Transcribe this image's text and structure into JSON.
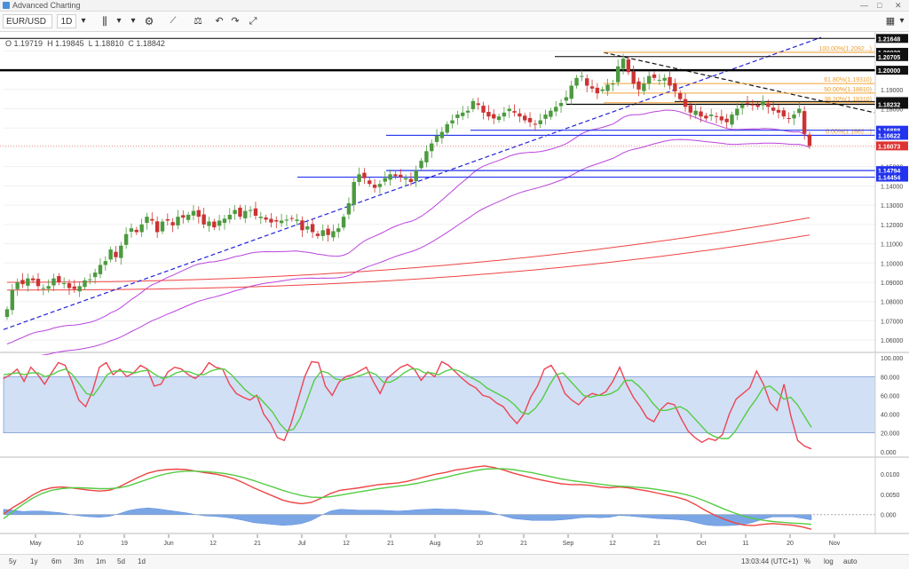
{
  "window": {
    "title": "Advanced Charting",
    "min": "—",
    "max": "□",
    "close": "✕"
  },
  "toolbar": {
    "symbol": "EUR/USD",
    "interval": "1D"
  },
  "ohlc": {
    "o": "O 1.19719",
    "h": "H 1.19845",
    "l": "L 1.18810",
    "c": "C 1.18842"
  },
  "bottom": {
    "ranges": [
      "5y",
      "1y",
      "6m",
      "3m",
      "1m",
      "5d",
      "1d"
    ],
    "time": "13:03:44 (UTC+1)",
    "pct": "%",
    "log": "log",
    "auto": "auto"
  },
  "colors": {
    "candle_up": "#4c9a3f",
    "candle_down": "#cc3333",
    "fib": "#f0a030",
    "trend_blue": "#2222dd",
    "ma_purple": "#bb44dd",
    "ma_red": "#ee4444",
    "rsi_red": "#ee4455",
    "rsi_green": "#55cc44",
    "band": "#c5d8f2",
    "hist": "#7aa6e6"
  },
  "chart_data": [
    {
      "type": "candlestick",
      "title": "EUR/USD",
      "ylim": [
        1.055,
        1.218
      ],
      "y_ticks": [
        1.06,
        1.07,
        1.08,
        1.09,
        1.1,
        1.11,
        1.12,
        1.13,
        1.14,
        1.15,
        1.16,
        1.17,
        1.18,
        1.19,
        1.2,
        1.21
      ],
      "y_tick_labels": [
        "1.06000",
        "1.07000",
        "1.08000",
        "1.09000",
        "1.10000",
        "1.11000",
        "1.12000",
        "1.13000",
        "1.14000",
        "1.15000",
        "1.16000",
        "1.17000",
        "1.18000",
        "1.19000",
        "1.20000",
        "1.21000"
      ],
      "x_ticks": [
        "May",
        "10",
        "19",
        "Jun",
        "12",
        "21",
        "Jul",
        "12",
        "21",
        "Aug",
        "10",
        "21",
        "Sep",
        "12",
        "21",
        "Oct",
        "11",
        "20",
        "Nov"
      ],
      "price_levels": [
        {
          "label": "1.21648",
          "value": 1.21648,
          "style": "plain"
        },
        {
          "label": "1.20928",
          "value": 1.20928,
          "style": "plain"
        },
        {
          "label": "1.20705",
          "value": 1.20705,
          "style": "plain"
        },
        {
          "label": "1.20000",
          "value": 1.2,
          "style": "plain"
        },
        {
          "label": "1.18373",
          "value": 1.18373,
          "style": "plain"
        },
        {
          "label": "1.18232",
          "value": 1.18232,
          "style": "plain"
        },
        {
          "label": "1.16888",
          "value": 1.16888,
          "style": "blue"
        },
        {
          "label": "1.16622",
          "value": 1.16622,
          "style": "blue"
        },
        {
          "label": "1.16073",
          "value": 1.16073,
          "style": "red"
        },
        {
          "label": "1.14794",
          "value": 1.14794,
          "style": "blue"
        },
        {
          "label": "1.14454",
          "value": 1.14454,
          "style": "blue"
        }
      ],
      "fib_labels": [
        {
          "label": "100.00%(1.2092...)",
          "value": 1.20928
        },
        {
          "label": "61.80%(1.19310)",
          "value": 1.1931
        },
        {
          "label": "50.00%(1.18810)",
          "value": 1.1881
        },
        {
          "label": "38.20%(1.18310)",
          "value": 1.1831
        },
        {
          "label": "0.00%(1.1662...)",
          "value": 1.16622
        }
      ],
      "closes": [
        1.076,
        1.086,
        1.09,
        1.089,
        1.092,
        1.091,
        1.088,
        1.087,
        1.088,
        1.092,
        1.09,
        1.0895,
        1.087,
        1.0865,
        1.088,
        1.091,
        1.0915,
        1.095,
        1.099,
        1.101,
        1.107,
        1.103,
        1.109,
        1.115,
        1.118,
        1.116,
        1.12,
        1.124,
        1.122,
        1.116,
        1.1215,
        1.122,
        1.1195,
        1.124,
        1.1235,
        1.125,
        1.127,
        1.124,
        1.12,
        1.1215,
        1.1185,
        1.122,
        1.123,
        1.125,
        1.1275,
        1.124,
        1.127,
        1.1275,
        1.1245,
        1.124,
        1.1225,
        1.121,
        1.1215,
        1.122,
        1.1225,
        1.123,
        1.1225,
        1.117,
        1.119,
        1.116,
        1.114,
        1.117,
        1.1145,
        1.1165,
        1.118,
        1.124,
        1.131,
        1.142,
        1.146,
        1.144,
        1.141,
        1.139,
        1.141,
        1.144,
        1.146,
        1.145,
        1.1445,
        1.144,
        1.142,
        1.148,
        1.153,
        1.158,
        1.162,
        1.166,
        1.168,
        1.172,
        1.174,
        1.177,
        1.178,
        1.179,
        1.184,
        1.182,
        1.178,
        1.176,
        1.175,
        1.176,
        1.178,
        1.18,
        1.178,
        1.176,
        1.174,
        1.173,
        1.172,
        1.174,
        1.177,
        1.179,
        1.181,
        1.183,
        1.186,
        1.192,
        1.196,
        1.197,
        1.192,
        1.1905,
        1.188,
        1.19,
        1.1925,
        1.193,
        1.202,
        1.206,
        1.199,
        1.193,
        1.19,
        1.193,
        1.197,
        1.196,
        1.195,
        1.196,
        1.192,
        1.189,
        1.185,
        1.181,
        1.178,
        1.179,
        1.176,
        1.175,
        1.177,
        1.176,
        1.174,
        1.173,
        1.177,
        1.18,
        1.182,
        1.183,
        1.182,
        1.181,
        1.184,
        1.181,
        1.179,
        1.178,
        1.176,
        1.175,
        1.177,
        1.18,
        1.167,
        1.1607
      ]
    },
    {
      "type": "line",
      "title": "",
      "ylim": [
        0,
        100
      ],
      "y_ticks": [
        0,
        20,
        40,
        60,
        80,
        100
      ],
      "y_tick_labels": [
        "0.000",
        "20.000",
        "40.000",
        "60.000",
        "80.000",
        "100.000"
      ],
      "band": [
        20,
        80
      ],
      "series": [
        {
          "color": "#ee4455",
          "values": [
            78,
            82,
            88,
            75,
            90,
            82,
            72,
            84,
            95,
            92,
            75,
            55,
            48,
            65,
            90,
            95,
            82,
            88,
            80,
            84,
            92,
            88,
            70,
            72,
            85,
            90,
            88,
            82,
            78,
            84,
            95,
            90,
            88,
            72,
            62,
            58,
            55,
            60,
            40,
            30,
            15,
            12,
            30,
            55,
            80,
            96,
            95,
            70,
            60,
            74,
            80,
            82,
            86,
            90,
            75,
            62,
            78,
            84,
            90,
            93,
            88,
            76,
            85,
            80,
            96,
            92,
            85,
            78,
            72,
            68,
            60,
            58,
            52,
            48,
            38,
            30,
            40,
            58,
            70,
            88,
            92,
            80,
            62,
            55,
            50,
            58,
            62,
            60,
            64,
            75,
            90,
            72,
            58,
            48,
            36,
            32,
            45,
            52,
            50,
            35,
            22,
            15,
            10,
            14,
            12,
            18,
            40,
            56,
            62,
            68,
            86,
            72,
            52,
            44,
            72,
            38,
            12,
            6,
            3
          ]
        },
        {
          "color": "#55cc44",
          "values": [
            82,
            83,
            84,
            82,
            84,
            84,
            80,
            82,
            86,
            88,
            82,
            72,
            62,
            60,
            70,
            82,
            86,
            86,
            85,
            84,
            86,
            87,
            82,
            78,
            80,
            84,
            86,
            85,
            82,
            82,
            86,
            88,
            88,
            82,
            74,
            66,
            60,
            58,
            50,
            42,
            30,
            22,
            24,
            36,
            56,
            76,
            86,
            84,
            78,
            76,
            78,
            80,
            82,
            85,
            82,
            74,
            74,
            78,
            84,
            88,
            88,
            84,
            84,
            82,
            86,
            88,
            86,
            82,
            78,
            74,
            68,
            64,
            60,
            56,
            50,
            42,
            40,
            46,
            56,
            70,
            82,
            84,
            76,
            68,
            60,
            58,
            60,
            60,
            62,
            66,
            76,
            76,
            70,
            62,
            52,
            44,
            44,
            46,
            48,
            44,
            36,
            28,
            20,
            16,
            14,
            14,
            22,
            34,
            46,
            56,
            68,
            70,
            64,
            56,
            58,
            50,
            38,
            26
          ]
        }
      ]
    },
    {
      "type": "line",
      "title": "",
      "ylim": [
        -0.004,
        0.0135
      ],
      "y_ticks": [
        0.0,
        0.005,
        0.01
      ],
      "y_tick_labels": [
        "0.000",
        "0.0050",
        "0.0100"
      ],
      "series": [
        {
          "color": "#ee4444",
          "values": [
            0.0002,
            0.0018,
            0.0032,
            0.0048,
            0.006,
            0.0066,
            0.0068,
            0.0066,
            0.0063,
            0.006,
            0.0058,
            0.006,
            0.0068,
            0.008,
            0.0092,
            0.0102,
            0.0108,
            0.0111,
            0.0112,
            0.0111,
            0.0107,
            0.0103,
            0.01,
            0.0095,
            0.0088,
            0.0078,
            0.0066,
            0.0056,
            0.0046,
            0.0036,
            0.003,
            0.0027,
            0.003,
            0.004,
            0.0052,
            0.006,
            0.0063,
            0.0066,
            0.007,
            0.0074,
            0.0076,
            0.0078,
            0.0082,
            0.0088,
            0.0094,
            0.01,
            0.0104,
            0.011,
            0.0113,
            0.0117,
            0.012,
            0.0116,
            0.011,
            0.0102,
            0.0096,
            0.009,
            0.0085,
            0.008,
            0.0076,
            0.0074,
            0.0074,
            0.0072,
            0.0068,
            0.0066,
            0.0068,
            0.0066,
            0.0062,
            0.0058,
            0.0053,
            0.0048,
            0.0043,
            0.0036,
            0.0024,
            0.001,
            -0.0002,
            -0.0012,
            -0.002,
            -0.0026,
            -0.0027,
            -0.0024,
            -0.0022,
            -0.0024,
            -0.0026,
            -0.003,
            -0.0036
          ]
        },
        {
          "color": "#55cc44",
          "values": [
            -0.001,
            0.0008,
            0.0025,
            0.004,
            0.0052,
            0.006,
            0.0064,
            0.0066,
            0.0066,
            0.0065,
            0.0064,
            0.0064,
            0.0066,
            0.0071,
            0.0079,
            0.0087,
            0.0095,
            0.0101,
            0.0105,
            0.0107,
            0.0107,
            0.0106,
            0.0104,
            0.0101,
            0.0097,
            0.0091,
            0.0084,
            0.0076,
            0.0068,
            0.006,
            0.0053,
            0.0047,
            0.0043,
            0.0042,
            0.0044,
            0.0048,
            0.0052,
            0.0056,
            0.006,
            0.0064,
            0.0067,
            0.007,
            0.0073,
            0.0077,
            0.0082,
            0.0087,
            0.0092,
            0.0098,
            0.0103,
            0.0108,
            0.0112,
            0.0113,
            0.0113,
            0.0111,
            0.0107,
            0.0103,
            0.0098,
            0.0093,
            0.0088,
            0.0084,
            0.0081,
            0.0078,
            0.0075,
            0.0072,
            0.007,
            0.0069,
            0.0067,
            0.0065,
            0.0062,
            0.0058,
            0.0054,
            0.0049,
            0.0042,
            0.0033,
            0.0023,
            0.0013,
            0.0004,
            -0.0004,
            -0.001,
            -0.0014,
            -0.0017,
            -0.0019,
            -0.0021,
            -0.0022,
            -0.0024
          ]
        }
      ]
    }
  ]
}
